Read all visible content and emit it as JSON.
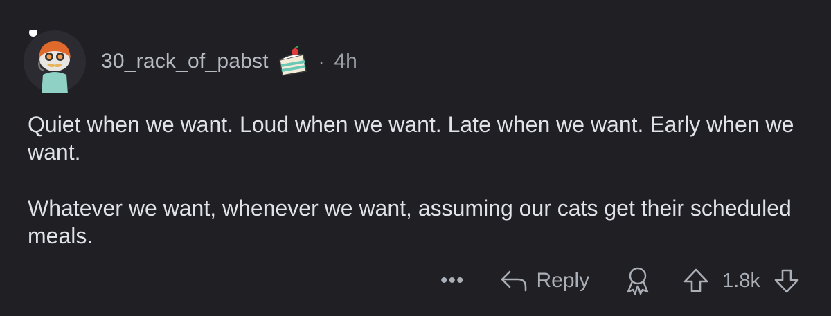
{
  "comment": {
    "username": "30_rack_of_pabst",
    "separator": "·",
    "time_ago": "4h",
    "paragraphs": [
      "Quiet when we want. Loud when we want. Late when we want. Early when we want.",
      "Whatever we want, whenever we want, assuming our cats get their scheduled meals."
    ]
  },
  "actions": {
    "more_label": "•••",
    "reply_label": "Reply",
    "score": "1.8k"
  },
  "icons": {
    "avatar": "snoo-avatar",
    "badge": "cake-day-icon",
    "reply": "reply-arrow-icon",
    "award": "award-icon",
    "upvote": "upvote-arrow-icon",
    "downvote": "downvote-arrow-icon"
  },
  "colors": {
    "background": "#1f1f24",
    "text": "#dfe2e8",
    "muted": "#a9aeb7"
  }
}
